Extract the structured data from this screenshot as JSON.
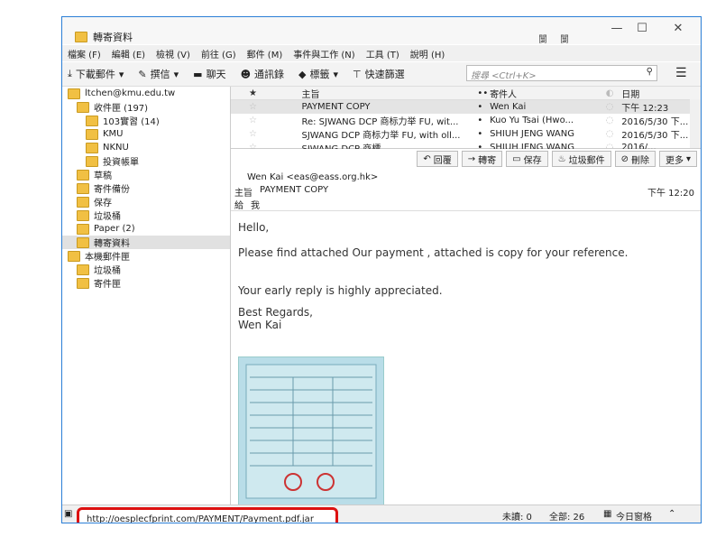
{
  "window": {
    "tab_title": "轉寄資料",
    "ctrl_small_1": "闅",
    "ctrl_small_2": "闅",
    "min": "—",
    "max": "☐",
    "close": "✕"
  },
  "menubar": [
    "檔案 (F)",
    "編輯 (E)",
    "檢視 (V)",
    "前往 (G)",
    "郵件 (M)",
    "事件與工作 (N)",
    "工具 (T)",
    "說明 (H)"
  ],
  "toolbar": {
    "download": "下載郵件",
    "compose": "撰信",
    "chat": "聊天",
    "contacts": "通訊錄",
    "tags": "標籤",
    "quickfilter": "快速篩選",
    "search_placeholder": "搜尋 <Ctrl+K>"
  },
  "sidebar": [
    {
      "label": "ltchen@kmu.edu.tw",
      "level": 0,
      "sel": false
    },
    {
      "label": "收件匣 (197)",
      "level": 1,
      "sel": false
    },
    {
      "label": "103實習 (14)",
      "level": 2,
      "sel": false
    },
    {
      "label": "KMU",
      "level": 2,
      "sel": false
    },
    {
      "label": "NKNU",
      "level": 2,
      "sel": false
    },
    {
      "label": "投資帳單",
      "level": 2,
      "sel": false
    },
    {
      "label": "草稿",
      "level": 1,
      "sel": false
    },
    {
      "label": "寄件備份",
      "level": 1,
      "sel": false
    },
    {
      "label": "保存",
      "level": 1,
      "sel": false
    },
    {
      "label": "垃圾桶",
      "level": 1,
      "sel": false
    },
    {
      "label": "Paper (2)",
      "level": 1,
      "sel": false
    },
    {
      "label": "轉寄資料",
      "level": 1,
      "sel": true
    },
    {
      "label": "本機郵件匣",
      "level": 0,
      "sel": false
    },
    {
      "label": "垃圾桶",
      "level": 1,
      "sel": false
    },
    {
      "label": "寄件匣",
      "level": 1,
      "sel": false
    }
  ],
  "list_headers": {
    "subject": "主旨",
    "from": "寄件人",
    "date": "日期"
  },
  "messages": [
    {
      "subject": "PAYMENT COPY",
      "from": "Wen Kai",
      "date": "下午 12:23",
      "sel": true
    },
    {
      "subject": "Re: SJWANG DCP 商标力举 FU, wit...",
      "from": "Kuo Yu Tsai (Hwo...",
      "date": "2016/5/30 下...",
      "sel": false
    },
    {
      "subject": "SJWANG DCP 商标力举 FU, with oll...",
      "from": "SHIUH JENG WANG",
      "date": "2016/5/30 下...",
      "sel": false
    },
    {
      "subject": "SJWANG DCP 商標...",
      "from": "SHIUH JENG WANG",
      "date": "2016/...",
      "sel": false
    }
  ],
  "actions": [
    "回覆",
    "轉寄",
    "保存",
    "垃圾郵件",
    "刪除",
    "更多"
  ],
  "header": {
    "from": "Wen Kai <eas@eass.org.hk>",
    "subject_label": "主旨",
    "subject": "PAYMENT COPY",
    "time": "下午 12:20",
    "to_label": "給",
    "to": "我"
  },
  "body": [
    "Hello,",
    "Please  find attached  Our payment , attached  is   copy  for your reference.",
    "Your early reply is highly appreciated.",
    "Best Regards,",
    "Wen Kai"
  ],
  "status": {
    "url": "http://oesplecfprint.com/PAYMENT/Payment.pdf.jar",
    "unread": "未讀: 0",
    "total": "全部: 26",
    "today": "今日窗格"
  }
}
